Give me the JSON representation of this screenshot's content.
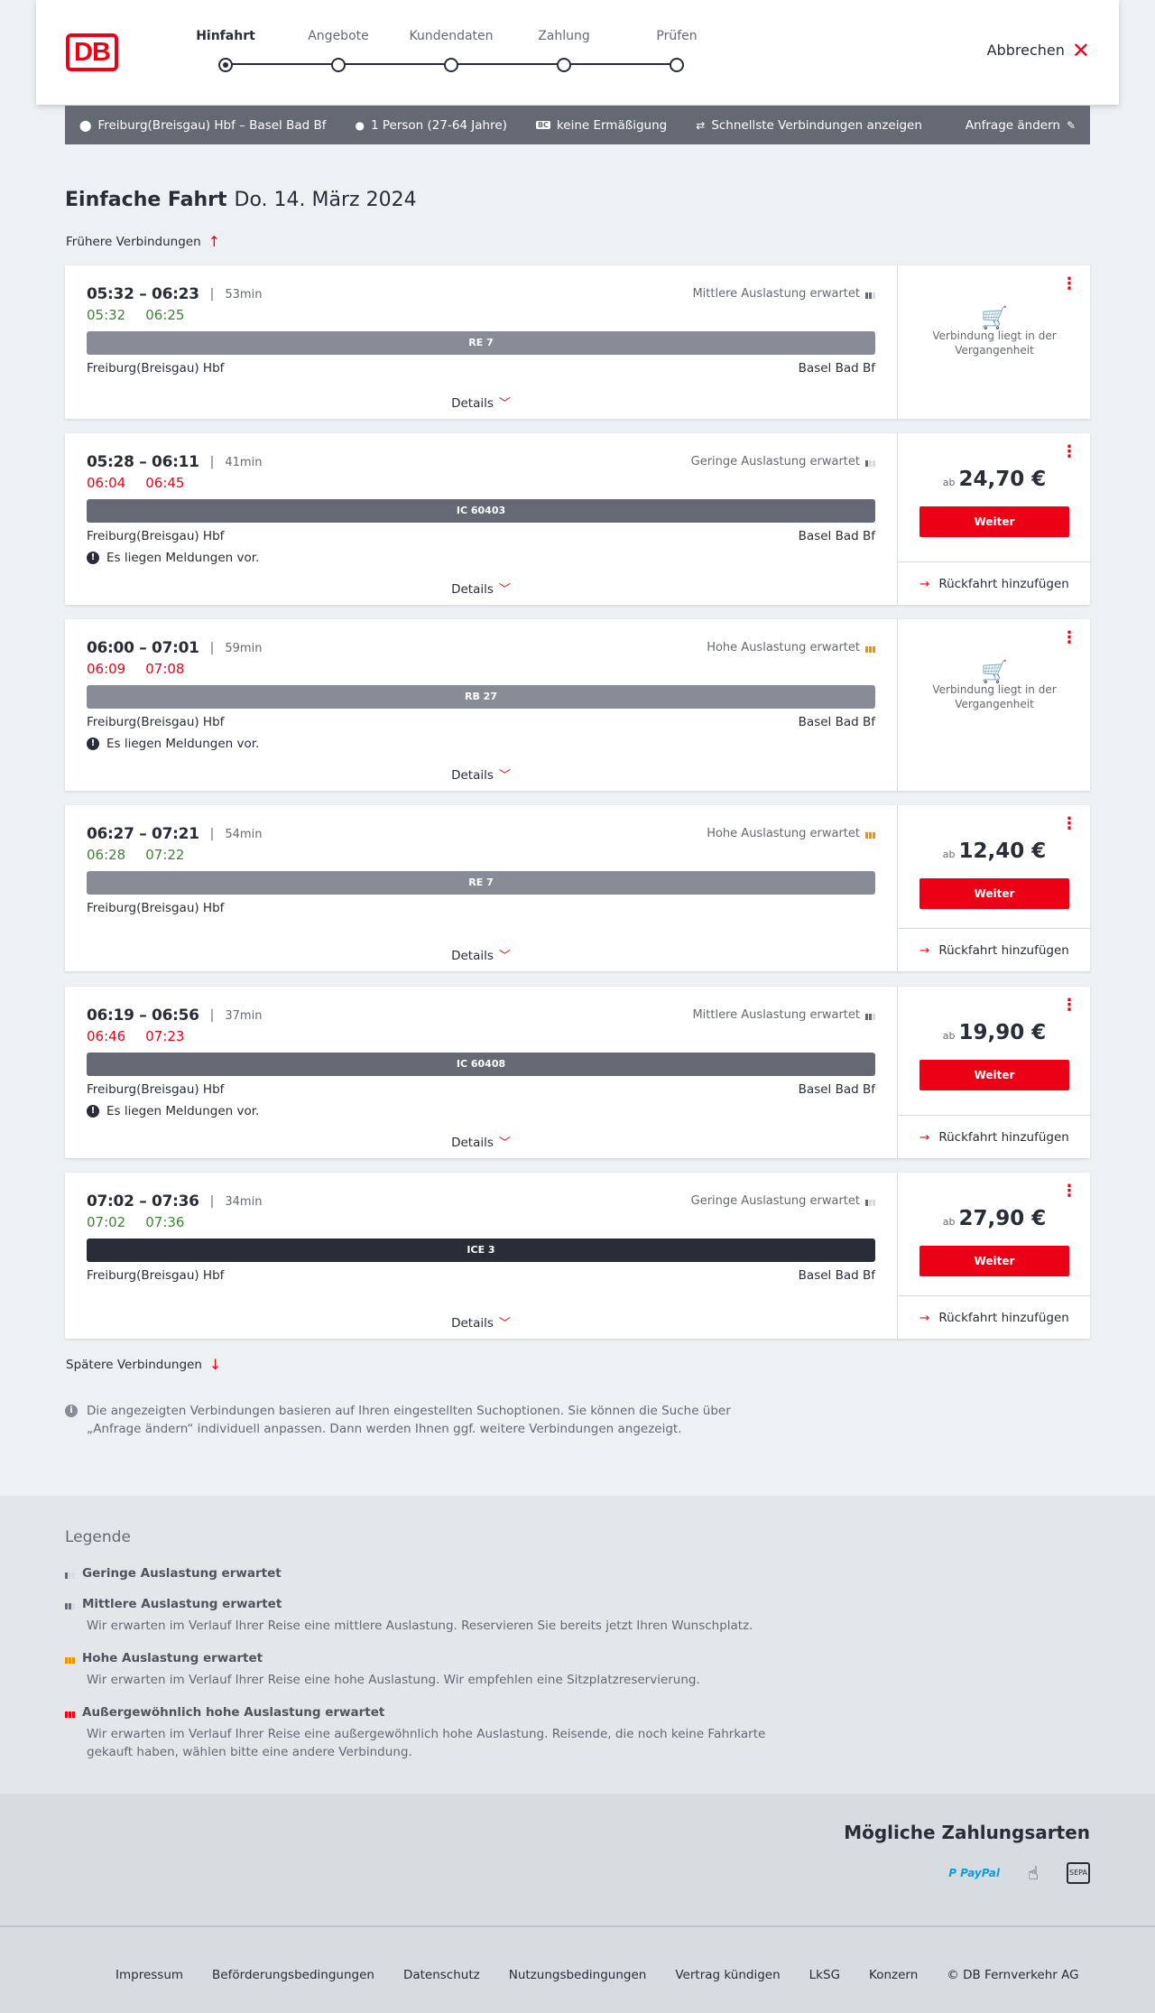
{
  "header": {
    "logo": "DB",
    "steps": [
      {
        "label": "Hinfahrt",
        "active": true
      },
      {
        "label": "Angebote",
        "active": false
      },
      {
        "label": "Kundendaten",
        "active": false
      },
      {
        "label": "Zahlung",
        "active": false
      },
      {
        "label": "Prüfen",
        "active": false
      }
    ],
    "cancel_label": "Abbrechen"
  },
  "summary": {
    "route": "Freiburg(Breisgau) Hbf – Basel Bad Bf",
    "travellers": "1 Person (27-64 Jahre)",
    "discount_badge": "BC",
    "discount": "keine Ermäßigung",
    "fastest": "Schnellste Verbindungen anzeigen",
    "change": "Anfrage ändern"
  },
  "page": {
    "title_type": "Einfache Fahrt",
    "title_date": "Do. 14. März 2024",
    "earlier": "Frühere Verbindungen",
    "later": "Spätere Verbindungen",
    "info": "Die angezeigten Verbindungen basieren auf Ihren eingestellten Suchoptionen. Sie können die Suche über „Anfrage ändern“ individuell anpassen. Dann werden Ihnen ggf. weitere Verbindungen angezeigt.",
    "details_label": "Details",
    "weiter_label": "Weiter",
    "return_label": "Rückfahrt hinzufügen",
    "price_prefix": "ab",
    "past_label": "Verbindung liegt in der Vergangenheit",
    "message_label": "Es liegen Meldungen vor."
  },
  "connections": [
    {
      "time": "05:32 – 06:23",
      "duration": "53min",
      "rt_dep": "05:32",
      "rt_arr": "06:25",
      "rt_color": "green",
      "load": "Mittlere Auslastung erwartet",
      "load_level": 2,
      "train": "RE 7",
      "train_color": "#878c96",
      "from": "Freiburg(Breisgau) Hbf",
      "to": "Basel Bad Bf",
      "message": false,
      "past": true,
      "price": ""
    },
    {
      "time": "05:28 – 06:11",
      "duration": "41min",
      "rt_dep": "06:04",
      "rt_arr": "06:45",
      "rt_color": "red",
      "load": "Geringe Auslastung erwartet",
      "load_level": 1,
      "train": "IC 60403",
      "train_color": "#646973",
      "from": "Freiburg(Breisgau) Hbf",
      "to": "Basel Bad Bf",
      "message": true,
      "past": false,
      "price": "24,70 €"
    },
    {
      "time": "06:00 – 07:01",
      "duration": "59min",
      "rt_dep": "06:09",
      "rt_arr": "07:08",
      "rt_color": "red",
      "load": "Hohe Auslastung erwartet",
      "load_level": 3,
      "train": "RB 27",
      "train_color": "#878c96",
      "from": "Freiburg(Breisgau) Hbf",
      "to": "Basel Bad Bf",
      "message": true,
      "past": true,
      "price": ""
    },
    {
      "time": "06:27 – 07:21",
      "duration": "54min",
      "rt_dep": "06:28",
      "rt_arr": "07:22",
      "rt_color": "green",
      "load": "Hohe Auslastung erwartet",
      "load_level": 3,
      "train": "RE 7",
      "train_color": "#878c96",
      "from": "Freiburg(Breisgau) Hbf",
      "to": "",
      "message": false,
      "past": false,
      "price": "12,40 €"
    },
    {
      "time": "06:19 – 06:56",
      "duration": "37min",
      "rt_dep": "06:46",
      "rt_arr": "07:23",
      "rt_color": "red",
      "load": "Mittlere Auslastung erwartet",
      "load_level": 2,
      "train": "IC 60408",
      "train_color": "#646973",
      "from": "Freiburg(Breisgau) Hbf",
      "to": "Basel Bad Bf",
      "message": true,
      "past": false,
      "price": "19,90 €"
    },
    {
      "time": "07:02 – 07:36",
      "duration": "34min",
      "rt_dep": "07:02",
      "rt_arr": "07:36",
      "rt_color": "green",
      "load": "Geringe Auslastung erwartet",
      "load_level": 1,
      "train": "ICE 3",
      "train_color": "#282d37",
      "from": "Freiburg(Breisgau) Hbf",
      "to": "Basel Bad Bf",
      "message": false,
      "past": false,
      "price": "27,90 €"
    }
  ],
  "legend": {
    "title": "Legende",
    "items": [
      {
        "title": "Geringe Auslastung erwartet",
        "desc": "",
        "level": 1
      },
      {
        "title": "Mittlere Auslastung erwartet",
        "desc": "Wir erwarten im Verlauf Ihrer Reise eine mittlere Auslastung. Reservieren Sie bereits jetzt Ihren Wunschplatz.",
        "level": 2
      },
      {
        "title": "Hohe Auslastung erwartet",
        "desc": "Wir erwarten im Verlauf Ihrer Reise eine hohe Auslastung. Wir empfehlen eine Sitzplatzreservierung.",
        "level": 3
      },
      {
        "title": "Außergewöhnlich hohe Auslastung erwartet",
        "desc": "Wir erwarten im Verlauf Ihrer Reise eine außergewöhnlich hohe Auslastung. Reisende, die noch keine Fahrkarte gekauft haben, wählen bitte eine andere Verbindung.",
        "level": 4
      }
    ]
  },
  "payment": {
    "title": "Mögliche Zahlungsarten",
    "methods": [
      "PayPal",
      "card-icon",
      "sepa-icon"
    ],
    "paypal_a": "P PayPal",
    "sepa_label": "SEPA"
  },
  "footer": {
    "links": [
      "Impressum",
      "Beförderungsbedingungen",
      "Datenschutz",
      "Nutzungsbedingungen",
      "Vertrag kündigen",
      "LkSG",
      "Konzern",
      "© DB Fernverkehr AG"
    ]
  },
  "colors": {
    "accent": "#ec0016",
    "green": "#408335",
    "orange": "#f39200"
  }
}
